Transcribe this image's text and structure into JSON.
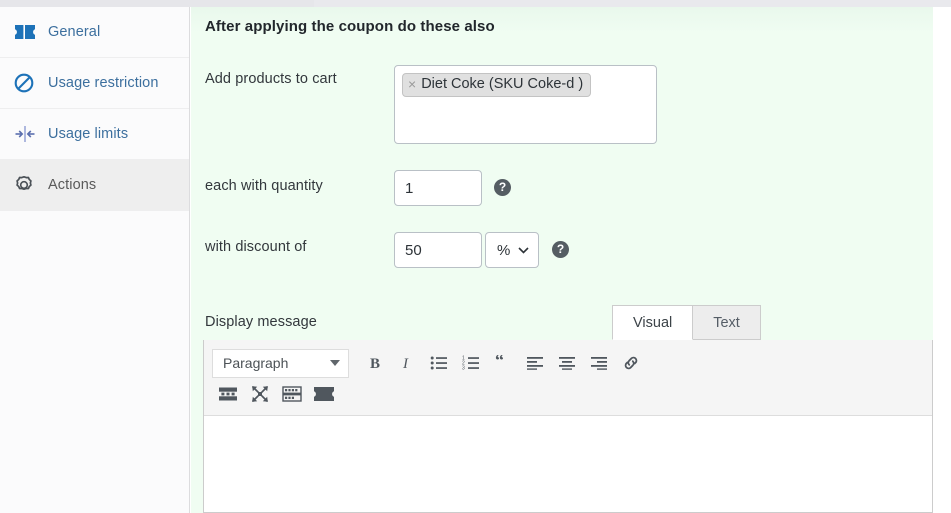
{
  "sidebar": {
    "items": [
      {
        "label": "General",
        "icon": "ticket-icon",
        "active": false
      },
      {
        "label": "Usage restriction",
        "icon": "no-entry-icon",
        "active": false
      },
      {
        "label": "Usage limits",
        "icon": "limits-icon",
        "active": false
      },
      {
        "label": "Actions",
        "icon": "gear-icon",
        "active": true
      }
    ]
  },
  "main": {
    "heading": "After applying the coupon do these also",
    "products_label": "Add products to cart",
    "product_chips": [
      {
        "remove": "×",
        "label": "Diet Coke (SKU Coke-d )"
      }
    ],
    "quantity_label": "each with quantity",
    "quantity_value": "1",
    "quantity_help": "?",
    "discount_label": "with discount of",
    "discount_value": "50",
    "discount_unit": "%",
    "discount_help": "?",
    "display_message_label": "Display message"
  },
  "editor": {
    "tabs": [
      {
        "label": "Visual",
        "active": true
      },
      {
        "label": "Text",
        "active": false
      }
    ],
    "format_select": "Paragraph",
    "toolbar_row1": [
      {
        "name": "bold-icon",
        "title": "Bold"
      },
      {
        "name": "italic-icon",
        "title": "Italic"
      },
      {
        "name": "bulleted-list-icon",
        "title": "Bulleted list"
      },
      {
        "name": "numbered-list-icon",
        "title": "Numbered list"
      },
      {
        "name": "blockquote-icon",
        "title": "Blockquote"
      },
      {
        "name": "align-left-icon",
        "title": "Align left"
      },
      {
        "name": "align-center-icon",
        "title": "Align center"
      },
      {
        "name": "align-right-icon",
        "title": "Align right"
      },
      {
        "name": "link-icon",
        "title": "Insert link"
      }
    ],
    "toolbar_row2": [
      {
        "name": "insert-more-icon",
        "title": "Insert Read More tag"
      },
      {
        "name": "fullscreen-icon",
        "title": "Distraction-free writing mode"
      },
      {
        "name": "toolbar-toggle-icon",
        "title": "Toolbar Toggle"
      },
      {
        "name": "coupon-ticket-icon",
        "title": "Insert coupon"
      }
    ],
    "content": ""
  },
  "colors": {
    "panel_background": "#f0fdf2",
    "sidebar_background": "#fbfbfc",
    "sidebar_active": "#eeeeee",
    "link_blue": "#3c6f9e",
    "accent_blue": "#1d72b8",
    "toolbar_background": "#f5f5f5",
    "help_badge": "#555d63"
  }
}
